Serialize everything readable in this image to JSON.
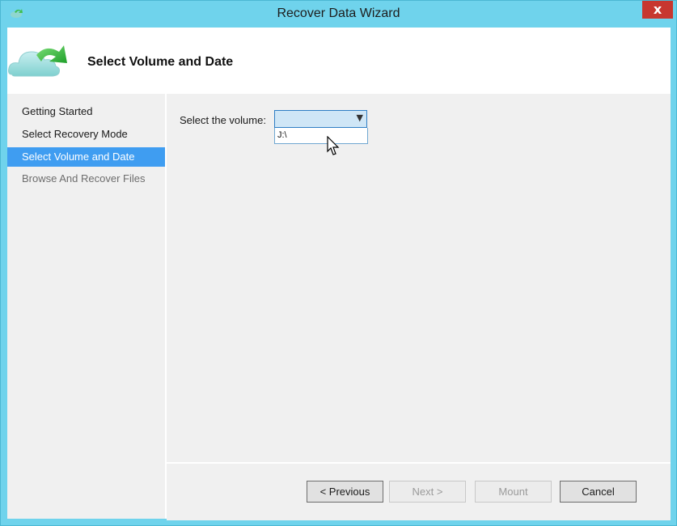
{
  "window": {
    "title": "Recover Data Wizard",
    "close_glyph": "x"
  },
  "header": {
    "title": "Select Volume and Date",
    "logo_icon": "cloud-recover-icon"
  },
  "nav": {
    "items": [
      {
        "label": "Getting Started",
        "state": "normal"
      },
      {
        "label": "Select Recovery Mode",
        "state": "normal"
      },
      {
        "label": "Select Volume and Date",
        "state": "active"
      },
      {
        "label": "Browse And Recover Files",
        "state": "disabled"
      }
    ]
  },
  "content": {
    "volume_label": "Select the volume:",
    "volume_selected": "",
    "volume_options": [
      "J:\\"
    ]
  },
  "footer": {
    "previous_label": "< Previous",
    "next_label": "Next >",
    "mount_label": "Mount",
    "cancel_label": "Cancel"
  },
  "colors": {
    "frame": "#6fd3ec",
    "selection": "#3f9df1",
    "close": "#c7372f"
  }
}
